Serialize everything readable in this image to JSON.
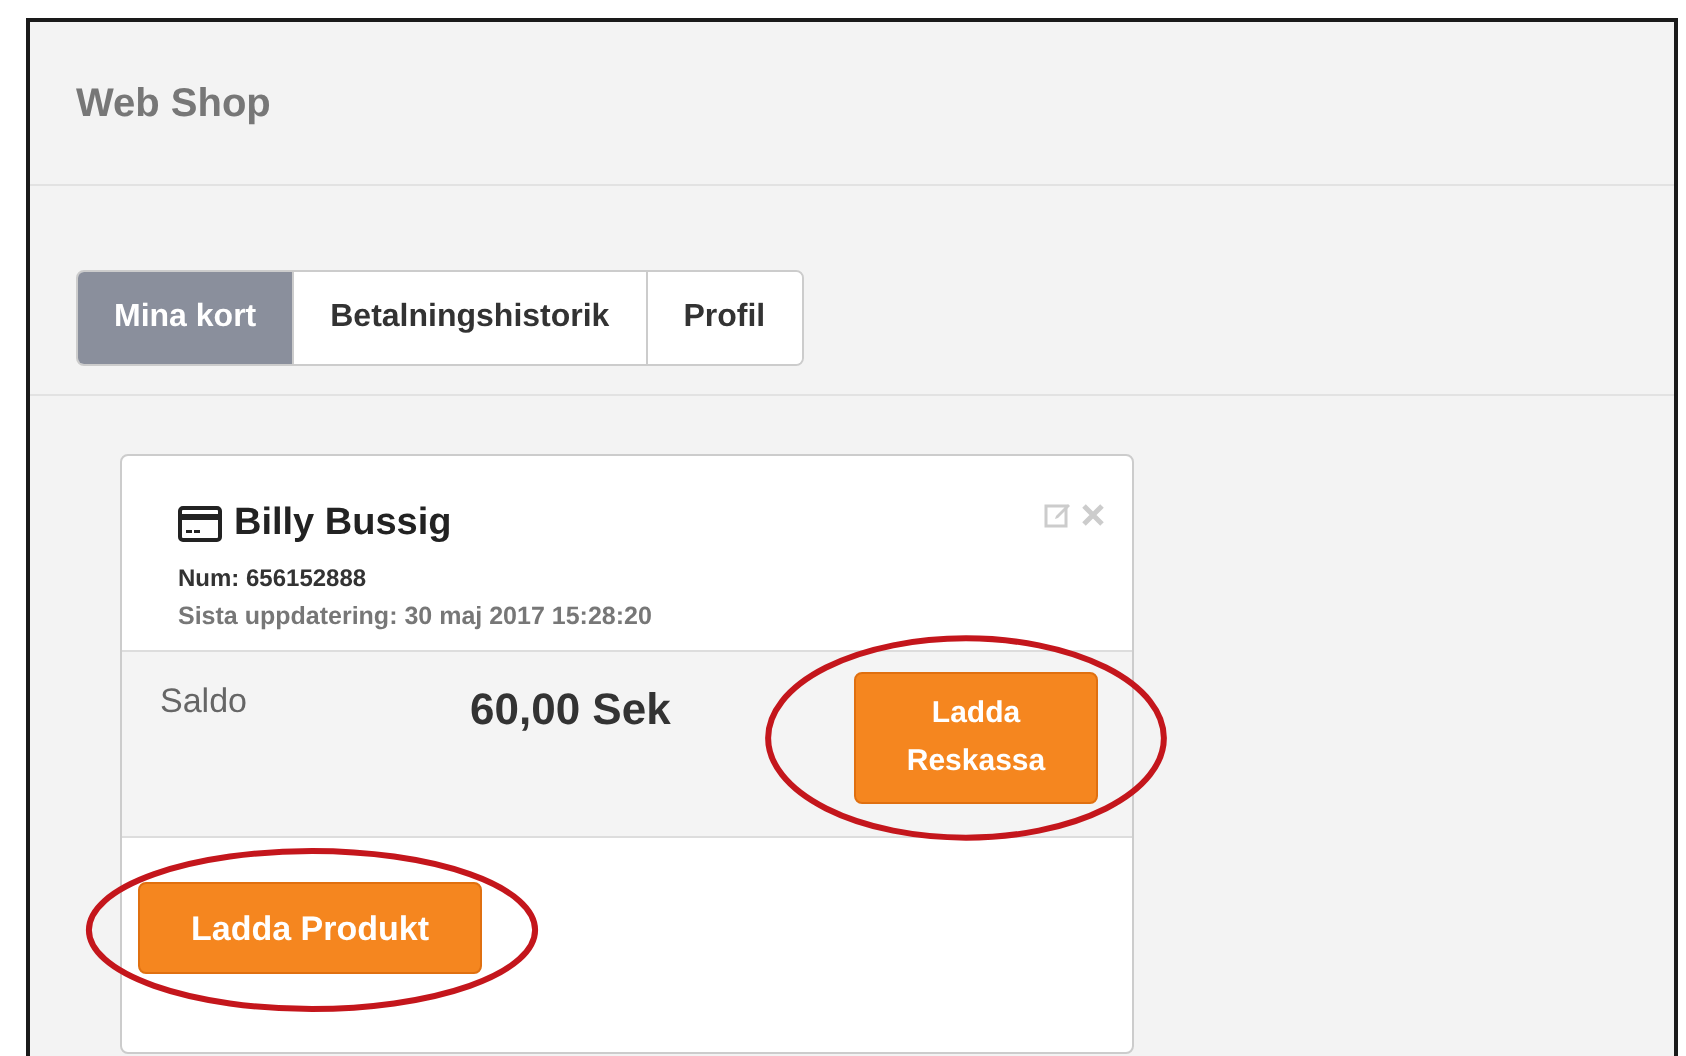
{
  "header": {
    "title": "Web Shop"
  },
  "tabs": [
    {
      "label": "Mina kort",
      "selected": true
    },
    {
      "label": "Betalningshistorik",
      "selected": false
    },
    {
      "label": "Profil",
      "selected": false
    }
  ],
  "card": {
    "name": "Billy Bussig",
    "number": "Num: 656152888",
    "updated": "Sista uppdatering: 30 maj 2017 15:28:20",
    "balance_label": "Saldo",
    "balance": "60,00 Sek",
    "topup_button": {
      "label": "Ladda Reskassa",
      "highlighted": true
    },
    "product_button": {
      "label": "Ladda Produkt",
      "highlighted": true
    }
  }
}
